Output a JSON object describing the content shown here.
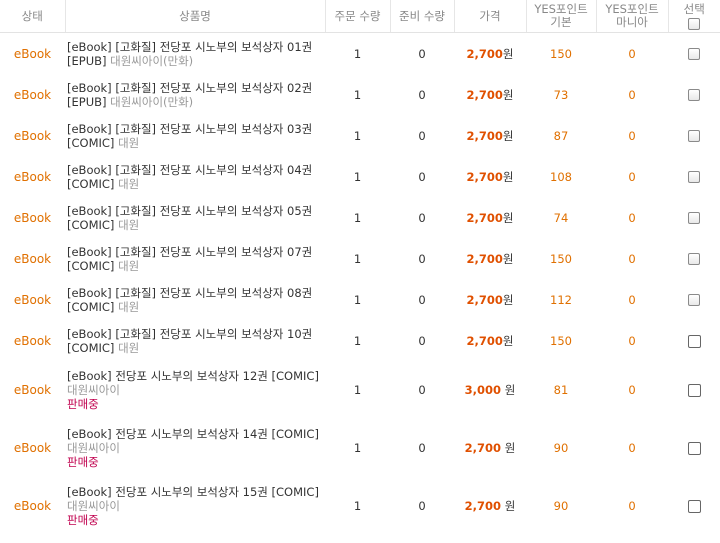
{
  "header": {
    "status": "상태",
    "name": "상품명",
    "order_qty": "주문 수량",
    "ready_qty": "준비 수량",
    "price": "가격",
    "point_basic_1": "YES포인트",
    "point_basic_2": "기본",
    "point_mania_1": "YES포인트",
    "point_mania_2": "마니아",
    "select": "선택"
  },
  "rows": [
    {
      "status": "eBook",
      "title": "[eBook] [고화질] 전당포 시노부의 보석상자 01권 [EPUB]",
      "publisher": "대원씨아이(만화)",
      "sale": "",
      "order_qty": "1",
      "ready_qty": "0",
      "price": "2,700",
      "unit": "원",
      "point_basic": "150",
      "point_mania": "0"
    },
    {
      "status": "eBook",
      "title": "[eBook] [고화질] 전당포 시노부의 보석상자 02권 [EPUB]",
      "publisher": "대원씨아이(만화)",
      "sale": "",
      "order_qty": "1",
      "ready_qty": "0",
      "price": "2,700",
      "unit": "원",
      "point_basic": "73",
      "point_mania": "0"
    },
    {
      "status": "eBook",
      "title": "[eBook] [고화질] 전당포 시노부의 보석상자 03권 [COMIC]",
      "publisher": "대원",
      "sale": "",
      "order_qty": "1",
      "ready_qty": "0",
      "price": "2,700",
      "unit": "원",
      "point_basic": "87",
      "point_mania": "0"
    },
    {
      "status": "eBook",
      "title": "[eBook] [고화질] 전당포 시노부의 보석상자 04권 [COMIC]",
      "publisher": "대원",
      "sale": "",
      "order_qty": "1",
      "ready_qty": "0",
      "price": "2,700",
      "unit": "원",
      "point_basic": "108",
      "point_mania": "0"
    },
    {
      "status": "eBook",
      "title": "[eBook] [고화질] 전당포 시노부의 보석상자 05권 [COMIC]",
      "publisher": "대원",
      "sale": "",
      "order_qty": "1",
      "ready_qty": "0",
      "price": "2,700",
      "unit": "원",
      "point_basic": "74",
      "point_mania": "0"
    },
    {
      "status": "eBook",
      "title": "[eBook] [고화질] 전당포 시노부의 보석상자 07권 [COMIC]",
      "publisher": "대원",
      "sale": "",
      "order_qty": "1",
      "ready_qty": "0",
      "price": "2,700",
      "unit": "원",
      "point_basic": "150",
      "point_mania": "0"
    },
    {
      "status": "eBook",
      "title": "[eBook] [고화질] 전당포 시노부의 보석상자 08권 [COMIC]",
      "publisher": "대원",
      "sale": "",
      "order_qty": "1",
      "ready_qty": "0",
      "price": "2,700",
      "unit": "원",
      "point_basic": "112",
      "point_mania": "0"
    },
    {
      "status": "eBook",
      "title": "[eBook] [고화질] 전당포 시노부의 보석상자 10권 [COMIC]",
      "publisher": "대원",
      "sale": "",
      "order_qty": "1",
      "ready_qty": "0",
      "price": "2,700",
      "unit": "원",
      "point_basic": "150",
      "point_mania": "0"
    },
    {
      "status": "eBook",
      "title": "[eBook] 전당포 시노부의 보석상자 12권 [COMIC]",
      "publisher": "대원씨아이",
      "sale": "판매중",
      "order_qty": "1",
      "ready_qty": "0",
      "price": "3,000",
      "unit": "원",
      "point_basic": "81",
      "point_mania": "0"
    },
    {
      "status": "eBook",
      "title": "[eBook] 전당포 시노부의 보석상자 14권 [COMIC]",
      "publisher": "대원씨아이",
      "sale": "판매중",
      "order_qty": "1",
      "ready_qty": "0",
      "price": "2,700",
      "unit": "원",
      "point_basic": "90",
      "point_mania": "0"
    },
    {
      "status": "eBook",
      "title": "[eBook] 전당포 시노부의 보석상자 15권 [COMIC]",
      "publisher": "대원씨아이",
      "sale": "판매중",
      "order_qty": "1",
      "ready_qty": "0",
      "price": "2,700",
      "unit": "원",
      "point_basic": "90",
      "point_mania": "0"
    }
  ]
}
